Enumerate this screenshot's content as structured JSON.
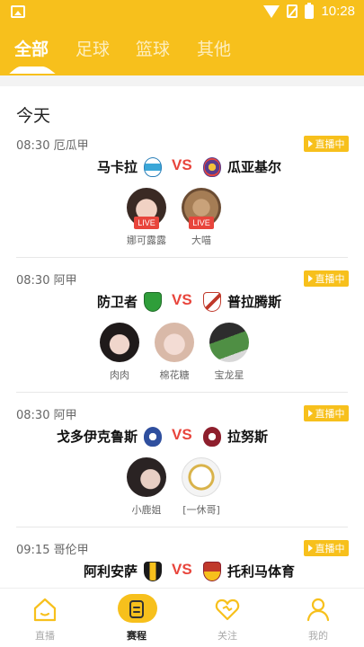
{
  "status_bar": {
    "time": "10:28"
  },
  "tabs": [
    {
      "label": "全部",
      "active": true
    },
    {
      "label": "足球",
      "active": false
    },
    {
      "label": "篮球",
      "active": false
    },
    {
      "label": "其他",
      "active": false
    }
  ],
  "section_title": "今天",
  "live_tag_label": "直播中",
  "live_badge_label": "LIVE",
  "vs_label": "VS",
  "matches": [
    {
      "time_league": "08:30 厄瓜甲",
      "home": "马卡拉",
      "away": "瓜亚基尔",
      "streamers": [
        {
          "name": "娜可露露",
          "live": true
        },
        {
          "name": "大喵",
          "live": true
        }
      ]
    },
    {
      "time_league": "08:30 阿甲",
      "home": "防卫者",
      "away": "普拉腾斯",
      "streamers": [
        {
          "name": "肉肉",
          "live": false
        },
        {
          "name": "棉花糖",
          "live": false
        },
        {
          "name": "宝龙星",
          "live": false
        }
      ]
    },
    {
      "time_league": "08:30 阿甲",
      "home": "戈多伊克鲁斯",
      "away": "拉努斯",
      "streamers": [
        {
          "name": "小鹿姐",
          "live": false
        },
        {
          "name": "[一休哥]",
          "live": false
        }
      ]
    },
    {
      "time_league": "09:15 哥伦甲",
      "home": "阿利安萨",
      "away": "托利马体育",
      "streamers": []
    }
  ],
  "bottom_nav": [
    {
      "label": "直播",
      "icon": "home-icon",
      "active": false
    },
    {
      "label": "赛程",
      "icon": "schedule-icon",
      "active": true
    },
    {
      "label": "关注",
      "icon": "heart-icon",
      "active": false
    },
    {
      "label": "我的",
      "icon": "person-icon",
      "active": false
    }
  ],
  "colors": {
    "accent": "#f7c01c",
    "live_red": "#e8453c",
    "vs_red": "#e8453c"
  }
}
